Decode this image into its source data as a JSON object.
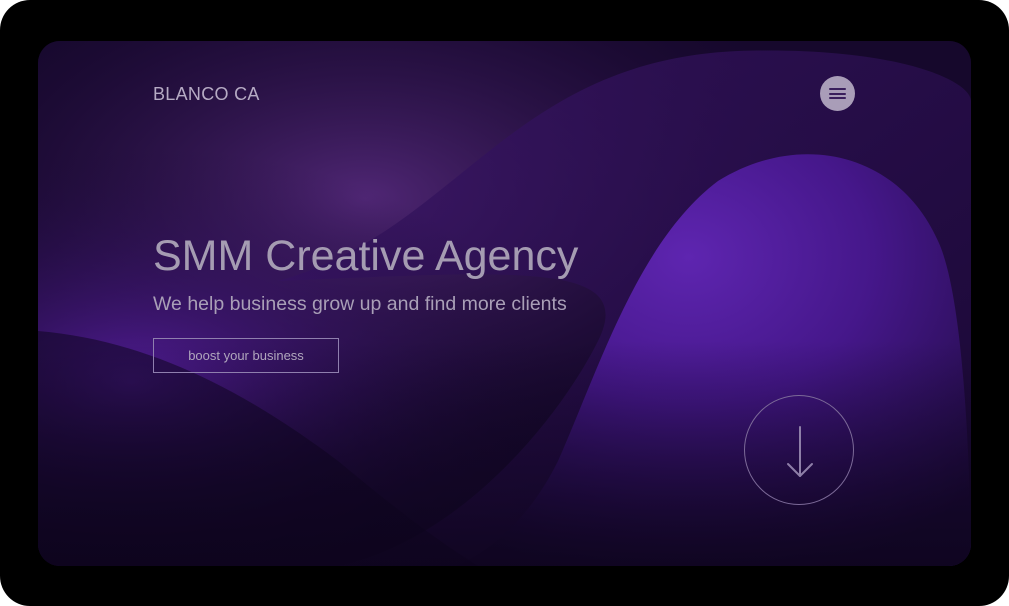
{
  "header": {
    "brand": "BLANCO CA",
    "menu_icon": "hamburger-menu-icon"
  },
  "hero": {
    "title": "SMM Creative Agency",
    "subtitle": "We help business grow up and find more clients",
    "cta_label": "boost your business",
    "scroll_icon": "arrow-down-icon"
  },
  "colors": {
    "background": "#14072a",
    "accent_purple": "#5b24a8",
    "text": "#a59cb2",
    "menu_button": "#a99db8"
  }
}
